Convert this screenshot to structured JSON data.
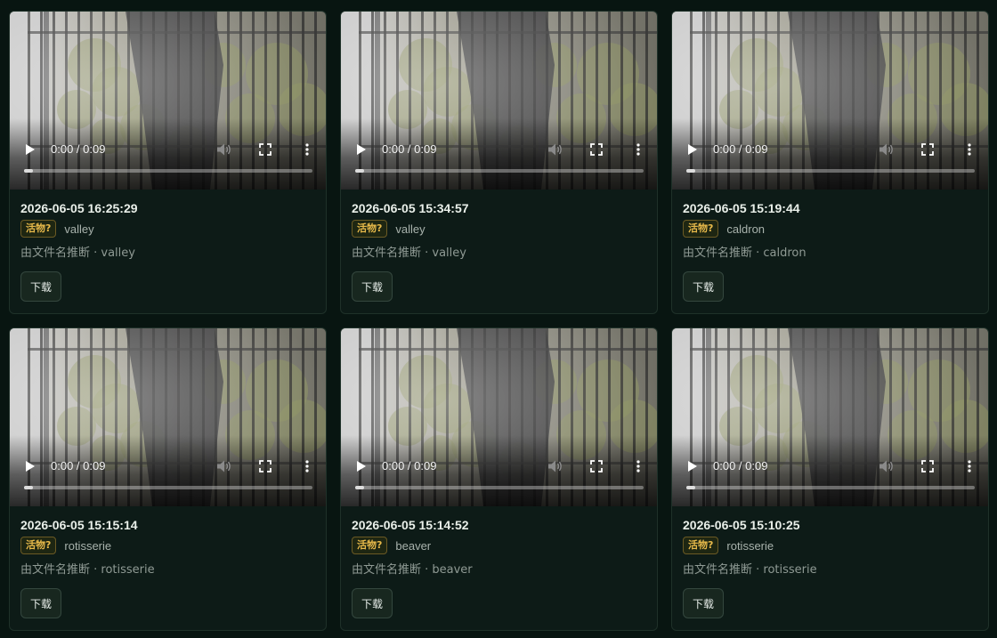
{
  "videos": [
    {
      "time": "0:00 / 0:09",
      "progress": 0.03,
      "timestamp": "2026-06-05 16:25:29",
      "badge": "活物?",
      "label": "valley",
      "inferred": "由文件名推断 · valley",
      "download": "下载"
    },
    {
      "time": "0:00 / 0:09",
      "progress": 0.03,
      "timestamp": "2026-06-05 15:34:57",
      "badge": "活物?",
      "label": "valley",
      "inferred": "由文件名推断 · valley",
      "download": "下载"
    },
    {
      "time": "0:00 / 0:09",
      "progress": 0.03,
      "timestamp": "2026-06-05 15:19:44",
      "badge": "活物?",
      "label": "caldron",
      "inferred": "由文件名推断 · caldron",
      "download": "下载"
    },
    {
      "time": "0:00 / 0:09",
      "progress": 0.03,
      "timestamp": "2026-06-05 15:15:14",
      "badge": "活物?",
      "label": "rotisserie",
      "inferred": "由文件名推断 · rotisserie",
      "download": "下载"
    },
    {
      "time": "0:00 / 0:09",
      "progress": 0.03,
      "timestamp": "2026-06-05 15:14:52",
      "badge": "活物?",
      "label": "beaver",
      "inferred": "由文件名推断 · beaver",
      "download": "下载"
    },
    {
      "time": "0:00 / 0:09",
      "progress": 0.03,
      "timestamp": "2026-06-05 15:10:25",
      "badge": "活物?",
      "label": "rotisserie",
      "inferred": "由文件名推断 · rotisserie",
      "download": "下载"
    }
  ],
  "icons": {
    "play": "play-icon",
    "volume": "volume-icon",
    "fullscreen": "fullscreen-icon",
    "more": "more-vertical-icon"
  },
  "colors": {
    "background": "#081511",
    "card": "#0d1b17",
    "badge_text": "#e7b94a",
    "badge_border": "#6b5a24"
  }
}
